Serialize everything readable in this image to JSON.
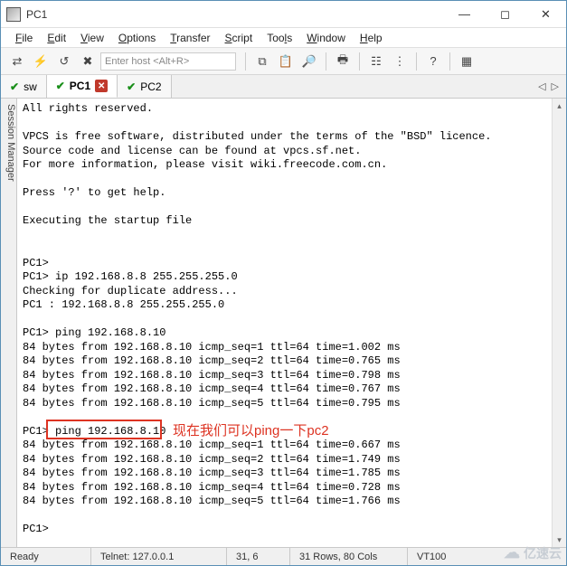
{
  "title": "PC1",
  "menubar": [
    "File",
    "Edit",
    "View",
    "Options",
    "Transfer",
    "Script",
    "Tools",
    "Window",
    "Help"
  ],
  "host_placeholder": "Enter host <Alt+R>",
  "tabs": [
    {
      "check": true,
      "label": "sw",
      "close": false
    },
    {
      "check": true,
      "label": "PC1",
      "close": true,
      "active": true
    },
    {
      "check": true,
      "label": "PC2",
      "close": false
    }
  ],
  "side_label": "Session Manager",
  "terminal_lines": [
    "All rights reserved.",
    "",
    "VPCS is free software, distributed under the terms of the \"BSD\" licence.",
    "Source code and license can be found at vpcs.sf.net.",
    "For more information, please visit wiki.freecode.com.cn.",
    "",
    "Press '?' to get help.",
    "",
    "Executing the startup file",
    "",
    "",
    "PC1>",
    "PC1> ip 192.168.8.8 255.255.255.0",
    "Checking for duplicate address...",
    "PC1 : 192.168.8.8 255.255.255.0",
    "",
    "PC1> ping 192.168.8.10",
    "84 bytes from 192.168.8.10 icmp_seq=1 ttl=64 time=1.002 ms",
    "84 bytes from 192.168.8.10 icmp_seq=2 ttl=64 time=0.765 ms",
    "84 bytes from 192.168.8.10 icmp_seq=3 ttl=64 time=0.798 ms",
    "84 bytes from 192.168.8.10 icmp_seq=4 ttl=64 time=0.767 ms",
    "84 bytes from 192.168.8.10 icmp_seq=5 ttl=64 time=0.795 ms",
    "",
    "PC1> ping 192.168.8.10",
    "84 bytes from 192.168.8.10 icmp_seq=1 ttl=64 time=0.667 ms",
    "84 bytes from 192.168.8.10 icmp_seq=2 ttl=64 time=1.749 ms",
    "84 bytes from 192.168.8.10 icmp_seq=3 ttl=64 time=1.785 ms",
    "84 bytes from 192.168.8.10 icmp_seq=4 ttl=64 time=0.728 ms",
    "84 bytes from 192.168.8.10 icmp_seq=5 ttl=64 time=1.766 ms",
    "",
    "PC1>"
  ],
  "callout_text": "现在我们可以ping一下pc2",
  "statusbar": {
    "ready": "Ready",
    "conn": "Telnet: 127.0.0.1",
    "cursor": "31,  6",
    "size": "31 Rows, 80 Cols",
    "emu": "VT100"
  },
  "watermark": "亿速云"
}
